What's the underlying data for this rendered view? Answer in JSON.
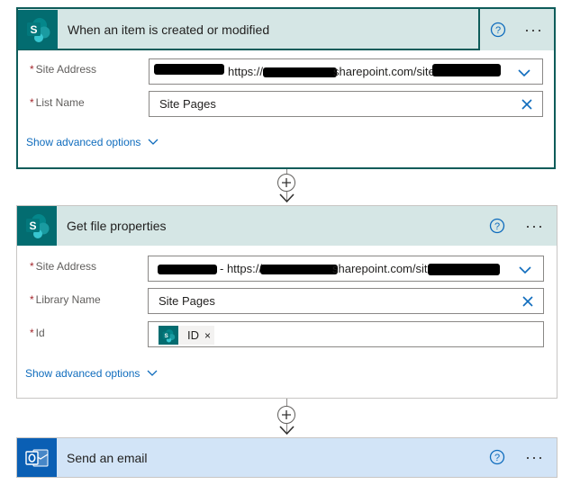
{
  "trigger": {
    "title": "When an item is created or modified",
    "fields": {
      "site_address": {
        "label": "Site Address",
        "value_prefix": "https://",
        "value_mid": "sharepoint.com/sites/"
      },
      "list_name": {
        "label": "List Name",
        "value": "Site Pages"
      }
    },
    "advanced": "Show advanced options"
  },
  "get_file": {
    "title": "Get file properties",
    "fields": {
      "site_address": {
        "label": "Site Address",
        "value_prefix": "- https://",
        "value_mid": "sharepoint.com/sites/"
      },
      "library_name": {
        "label": "Library Name",
        "value": "Site Pages"
      },
      "id": {
        "label": "Id",
        "token": "ID",
        "token_remove": "×"
      }
    },
    "advanced": "Show advanced options"
  },
  "send_email": {
    "title": "Send an email"
  },
  "required_marker": "*",
  "more_glyph": "···",
  "colors": {
    "sharepoint_teal": "#036c70",
    "outlook_blue": "#0a5fb4",
    "link_blue": "#0f6cbd",
    "required_red": "#a4262c"
  }
}
